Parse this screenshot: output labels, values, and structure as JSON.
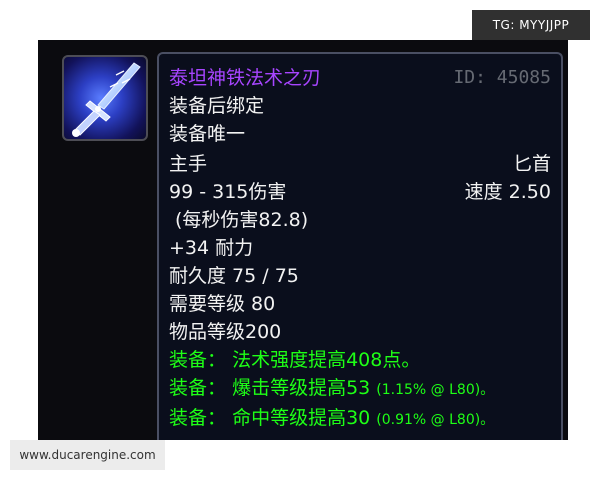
{
  "item": {
    "icon": "sword-icon",
    "name": "泰坦神铁法术之刃",
    "id_text": "ID: 45085",
    "binding": "装备后绑定",
    "unique": "装备唯一",
    "slot": "主手",
    "weapon_type": "匕首",
    "damage": "99 - 315伤害",
    "speed": "速度 2.50",
    "dps": "(每秒伤害82.8)",
    "stamina": "+34 耐力",
    "durability": "耐久度 75 / 75",
    "required_level": "需要等级 80",
    "item_level": "物品等级200",
    "equip_effects": [
      {
        "prefix": "装备：",
        "text": "法术强度提高408点。",
        "detail": ""
      },
      {
        "prefix": "装备：",
        "text": "爆击等级提高53",
        "detail": "(1.15% @ L80)。"
      },
      {
        "prefix": "装备：",
        "text": "命中等级提高30",
        "detail": "(0.91% @ L80)。"
      }
    ]
  },
  "watermarks": {
    "top": "TG: MYYJJPP",
    "bottom": "www.ducarengine.com"
  },
  "colors": {
    "epic_purple": "#a745ff",
    "equip_green": "#1eff16",
    "id_gray": "#666a73",
    "text_white": "#f2f2f2",
    "tooltip_bg": "#0a0e1c"
  }
}
